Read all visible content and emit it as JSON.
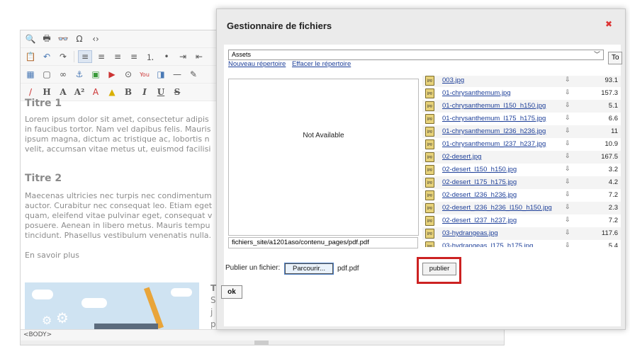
{
  "editor": {
    "headings": [
      "Titre 1",
      "Titre 2"
    ],
    "paragraph1": [
      "Lorem ipsum dolor sit amet, consectetur adipis",
      "in faucibus tortor. Nam vel dapibus felis. Mauris",
      "ipsum magna, dictum ac tristique ac, lobortis n",
      "velit, accumsan vitae metus ut, euismod facilisi"
    ],
    "paragraph2": [
      "Maecenas ultricies nec turpis nec condimentum",
      "auctor. Curabitur nec consequat leo. Etiam eget",
      "quam, eleifend vitae pulvinar eget, consequat v",
      "posuere. Aenean in libero metus. Mauris tempu",
      "tincidunt. Phasellus vestibulum venenatis nulla."
    ],
    "link_text": "En savoir plus",
    "right_text": [
      "T",
      "S",
      "j",
      "p"
    ],
    "status": "<BODY>",
    "toolbar": {
      "row1": [
        "search-icon",
        "print-icon",
        "binoculars-icon",
        "omega-icon",
        "html-icon"
      ],
      "row1_text": [
        "🔍",
        "🖶",
        "👓",
        "Ω",
        "‹›"
      ],
      "row2_text": [
        "📋",
        "↶",
        "↷",
        "≡",
        "≡",
        "≡",
        "≡",
        "⒈",
        "•",
        "⇥",
        "⇤"
      ],
      "row3_text": [
        "▦",
        "▢",
        "∞",
        "⚓",
        "▣",
        "▶",
        "⊙",
        "You",
        "◨",
        "—",
        "✎"
      ],
      "row4_text": [
        "/",
        "H",
        "A",
        "A²",
        "A",
        "▲",
        "B",
        "I",
        "U",
        "S"
      ]
    }
  },
  "dialog": {
    "title": "Gestionnaire de fichiers",
    "close_icon": "close-icon",
    "folder_value": "Assets",
    "to_button": "To",
    "new_folder_link": "Nouveau répertoire",
    "delete_folder_link": "Effacer le répertoire",
    "preview_text": "Not Available",
    "path": "fichiers_site/a1201aso/contenu_pages/pdf.pdf",
    "files": [
      {
        "name": "003.jpg",
        "size": "93.1"
      },
      {
        "name": "01-chrysanthemum.jpg",
        "size": "157.3"
      },
      {
        "name": "01-chrysanthemum_l150_h150.jpg",
        "size": "5.1"
      },
      {
        "name": "01-chrysanthemum_l175_h175.jpg",
        "size": "6.6"
      },
      {
        "name": "01-chrysanthemum_l236_h236.jpg",
        "size": "11"
      },
      {
        "name": "01-chrysanthemum_l237_h237.jpg",
        "size": "10.9"
      },
      {
        "name": "02-desert.jpg",
        "size": "167.5"
      },
      {
        "name": "02-desert_l150_h150.jpg",
        "size": "3.2"
      },
      {
        "name": "02-desert_l175_h175.jpg",
        "size": "4.2"
      },
      {
        "name": "02-desert_l236_h236.jpg",
        "size": "7.2"
      },
      {
        "name": "02-desert_l236_h236_l150_h150.jpg",
        "size": "2.3"
      },
      {
        "name": "02-desert_l237_h237.jpg",
        "size": "7.2"
      },
      {
        "name": "03-hydrangeas.jpg",
        "size": "117.6"
      },
      {
        "name": "03-hydrangeas_l175_h175.jpg",
        "size": "5.4"
      }
    ],
    "file_icon_label": "jpg",
    "download_glyph": "⇩",
    "upload_label": "Publier un fichier:",
    "browse_label": "Parcourir...",
    "chosen_file": "pdf.pdf",
    "publish_label": "publier",
    "ok_label": "ok",
    "highlight_color": "#cc2222"
  }
}
